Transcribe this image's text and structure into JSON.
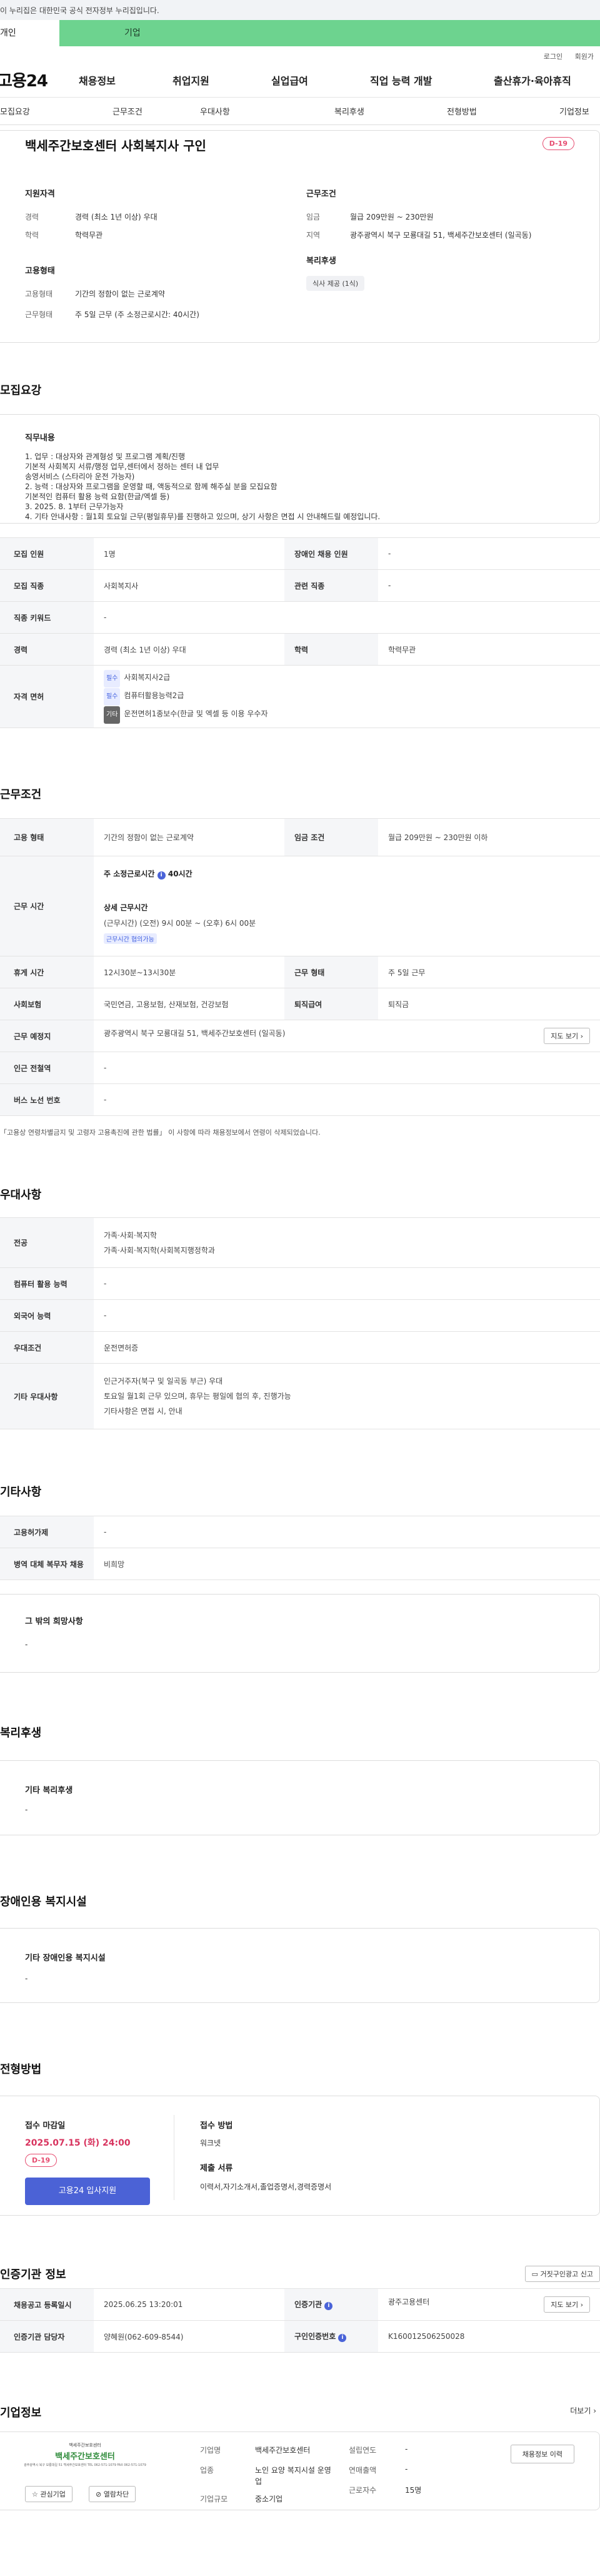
{
  "gov_banner": "이 누리집은 대한민국 공식 전자정부 누리집입니다.",
  "user_tabs": {
    "individual": "개인",
    "business": "기업"
  },
  "util": {
    "login": "로그인",
    "join": "회원가"
  },
  "logo": "고용24",
  "gnb": [
    "채용정보",
    "취업지원",
    "실업급여",
    "직업 능력 개발",
    "출산휴가·육아휴직"
  ],
  "subnav": [
    "모집요강",
    "근무조건",
    "우대사항",
    "복리후생",
    "전형방법",
    "기업정보"
  ],
  "job": {
    "title": "백세주간보호센터 사회복지사 구인",
    "dday": "D-19"
  },
  "summary": {
    "qual_title": "지원자격",
    "qual": [
      [
        "경력",
        "경력 (최소 1년 이상) 우대"
      ],
      [
        "학력",
        "학력무관"
      ]
    ],
    "cond_title": "근무조건",
    "cond": [
      [
        "임금",
        "월급 209만원 ~ 230만원"
      ],
      [
        "지역",
        "광주광역시 북구 모룡대길 51, 백세주간보호센터 (일곡동)"
      ]
    ],
    "emp_title": "고용형태",
    "emp": [
      [
        "고용형태",
        "기간의 정함이 없는 근로계약"
      ],
      [
        "근무형태",
        "주 5일 근무 (주 소정근로시간: 40시간)"
      ]
    ],
    "welfare_title": "복리후생",
    "welfare_tag": "식사 제공 (1식)"
  },
  "recruit": {
    "title": "모집요강",
    "duty_title": "직무내용",
    "duty_lines": [
      "1. 업무 : 대상자와 관계형성 및 프로그램 계획/진행",
      "기본적 사회복지 서류/행정 업무,센터에서 정하는 센터 내 업무",
      "송영서비스 (스타리아 운전 가능자)",
      "2. 능력 : 대상자와 프로그램을 운영할 때, 액동적으로 함께 해주실 분을 모집요함",
      "기본적인 컴퓨터 활용 능력 요함(한글/엑셀 등)",
      "3. 2025. 8. 1부터 근무가능자",
      "4. 기타 안내사항 : 월1회 토요일 근무(평일휴무)를 진행하고 있으며, 상기 사항은 면접 시 안내해드릴 예정입니다."
    ],
    "rows": [
      [
        "모집 인원",
        "1명",
        "장애인 채용 인원",
        "-"
      ],
      [
        "모집 직종",
        "사회복지사",
        "관련 직종",
        "-"
      ],
      [
        "직종 키워드",
        "-"
      ],
      [
        "경력",
        "경력 (최소 1년 이상) 우대",
        "학력",
        "학력무관"
      ]
    ],
    "license_label": "자격 면허",
    "licenses": [
      {
        "tag": "필수",
        "text": "사회복지사2급"
      },
      {
        "tag": "필수",
        "text": "컴퓨터활용능력2급"
      },
      {
        "tag": "기타",
        "text": "운전면허1종보수(한글 및 엑셀 등 이용 우수자"
      }
    ]
  },
  "work": {
    "title": "근무조건",
    "r1": [
      "고용 형태",
      "기간의 정함이 없는 근로계약",
      "임금 조건",
      "월급 209만원 ~ 230만원 이하"
    ],
    "time_label": "근무 시간",
    "weekly": "주 소정근로시간",
    "weekly_val": "40시간",
    "detail_title": "상세 근무시간",
    "detail_val": "(근무시간) (오전) 9시 00분 ~ (오후) 6시 00분",
    "flex": "근무시간 협의가능",
    "r3": [
      "휴게 시간",
      "12시30분~13시30분",
      "근무 형태",
      "주 5일 근무"
    ],
    "r4": [
      "사회보험",
      "국민연금, 고용보험, 산재보험, 건강보험",
      "퇴직급여",
      "퇴직금"
    ],
    "r5": [
      "근무 예정지",
      "광주광역시 북구 모룡대길 51, 백세주간보호센터 (일곡동)"
    ],
    "map": "지도 보기",
    "r6": [
      "인근 전철역",
      "-"
    ],
    "r7": [
      "버스 노선 번호",
      "-"
    ],
    "notice": "「고용상 연령차별금지 및 고령자 고용촉진에 관한 법률」 이 사항에 따라 채용정보에서 연령이 삭제되었습니다."
  },
  "pref": {
    "title": "우대사항",
    "major_label": "전공",
    "majors": [
      "가족·사회·복지학",
      "가족·사회·복지학(사회복지행정학과"
    ],
    "rows": [
      [
        "컴퓨터 활용 능력",
        "-"
      ],
      [
        "외국어 능력",
        "-"
      ],
      [
        "우대조건",
        "운전면허증"
      ]
    ],
    "etc_label": "기타 우대사항",
    "etc": [
      "인근거주자(북구 및 일곡동 부근) 우대",
      "토요일 월1회 근무 있으며, 휴무는 평일에 협의 후, 진행가능",
      "기타사항은 면접 시, 안내"
    ]
  },
  "other": {
    "title": "기타사항",
    "rows": [
      [
        "고용허가제",
        "-"
      ],
      [
        "병역 대체 복무자 채용",
        "비희망"
      ]
    ],
    "hope_title": "그 밖의 희망사항",
    "hope_val": "-"
  },
  "welfare": {
    "title": "복리후생",
    "box_title": "기타 복리후생",
    "box_val": "-"
  },
  "disabled": {
    "title": "장애인용 복지시설",
    "box_title": "기타 장애인용 복지시설",
    "box_val": "-"
  },
  "selection": {
    "title": "전형방법",
    "deadline_label": "접수 마감일",
    "deadline": "2025.07.15 (화) 24:00",
    "dday": "D-19",
    "apply": "고용24 입사지원",
    "method_label": "접수 방법",
    "method": "워크넷",
    "docs_label": "제출 서류",
    "docs": "이력서,자기소개서,졸업증명서,경력증명서"
  },
  "cert": {
    "title": "인증기관 정보",
    "report": "거짓구인광고 신고",
    "r1": [
      "채용공고 등록일시",
      "2025.06.25 13:20:01",
      "인증기관",
      "광주고용센터"
    ],
    "map": "지도 보기",
    "r2": [
      "인증기관 담당자",
      "양혜원(062-609-8544)",
      "구인인증번호",
      "K160012506250028"
    ]
  },
  "company": {
    "title": "기업정보",
    "more": "더보기",
    "logo_top": "백세주간보호센터",
    "logo_name": "백세주간보호센터",
    "logo_sub": "광주광역시 북구 모룡대길 51 백세주간보호센터 TEL 062-571-1079 FAX 062-571-1079",
    "name_label": "기업명",
    "name": "백세주간보호센터",
    "industry_label": "업종",
    "industry": "노인 요양 복지시설 운영업",
    "size_label": "기업규모",
    "size": "중소기업",
    "year_label": "설립연도",
    "year": "-",
    "sales_label": "연매출액",
    "sales": "-",
    "emp_label": "근로자수",
    "emp": "15명",
    "btn_list": "채용정보 이력",
    "btn_fav": "관심기업",
    "btn_fav2": "열람차단"
  }
}
